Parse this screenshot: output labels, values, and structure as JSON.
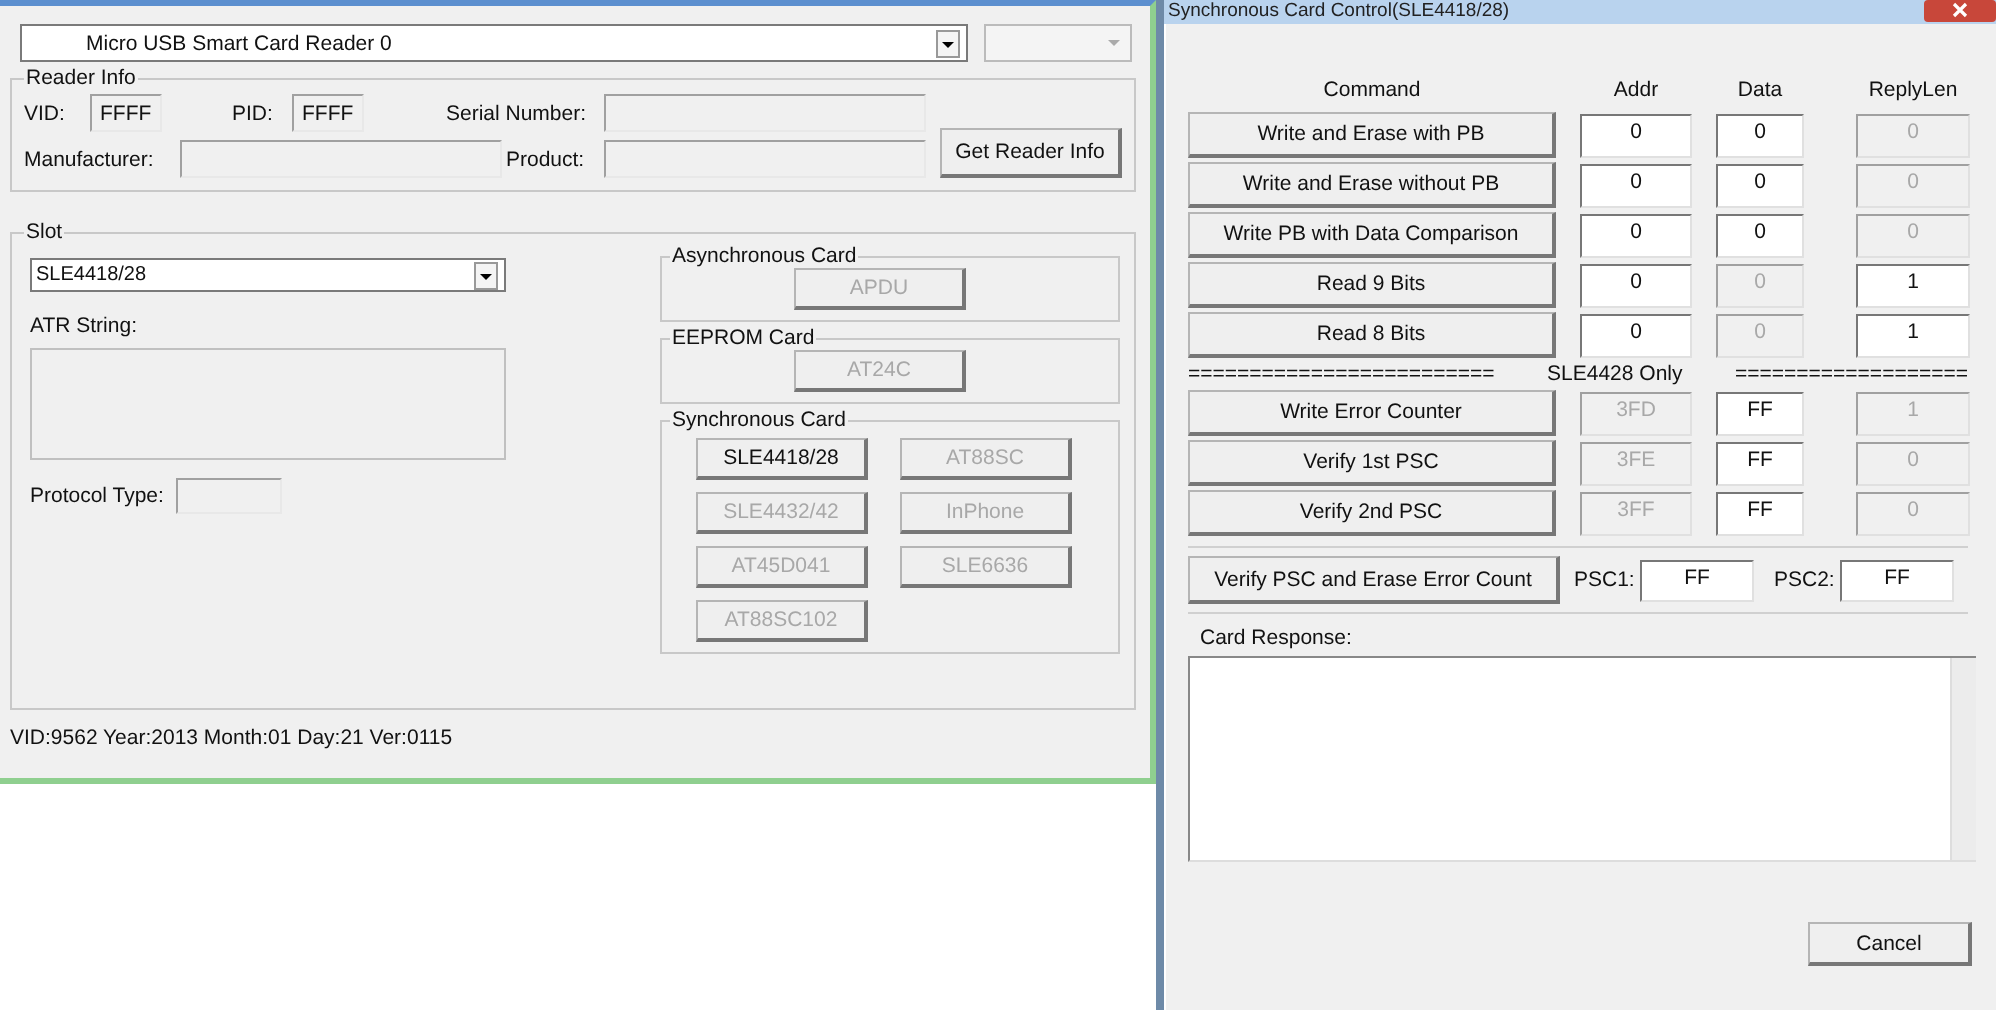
{
  "reader_window": {
    "reader_select": {
      "value": "Micro USB Smart Card Reader 0"
    },
    "reader_info": {
      "title": "Reader Info",
      "vid_label": "VID:",
      "vid": "FFFF",
      "pid_label": "PID:",
      "pid": "FFFF",
      "serial_label": "Serial Number:",
      "manufacturer_label": "Manufacturer:",
      "product_label": "Product:",
      "button": "Get Reader Info"
    },
    "slot": {
      "title": "Slot",
      "card_select": {
        "value": "SLE4418/28"
      },
      "atr_label": "ATR String:",
      "protocol_label": "Protocol Type:",
      "groups": [
        {
          "title": "Asynchronous Card",
          "buttons": [
            {
              "label": "APDU",
              "disabled": true
            }
          ]
        },
        {
          "title": "EEPROM Card",
          "buttons": [
            {
              "label": "AT24C",
              "disabled": true
            }
          ]
        },
        {
          "title": "Synchronous Card",
          "buttons": [
            {
              "label": "SLE4418/28",
              "disabled": false
            },
            {
              "label": "AT88SC",
              "disabled": true
            },
            {
              "label": "SLE4432/42",
              "disabled": true
            },
            {
              "label": "InPhone",
              "disabled": true
            },
            {
              "label": "AT45D041",
              "disabled": true
            },
            {
              "label": "SLE6636",
              "disabled": true
            },
            {
              "label": "AT88SC102",
              "disabled": true
            }
          ]
        }
      ]
    },
    "status": "VID:9562 Year:2013 Month:01 Day:21 Ver:0115"
  },
  "control_window": {
    "title": "Synchronous Card Control(SLE4418/28)",
    "columns": [
      "Command",
      "Addr",
      "Data",
      "ReplyLen"
    ],
    "rows": [
      {
        "command": "Write and Erase with PB",
        "addr": {
          "value": "0",
          "disabled": false
        },
        "data": {
          "value": "0",
          "disabled": false
        },
        "reply_len": {
          "value": "0",
          "disabled": true
        }
      },
      {
        "command": "Write and Erase without PB",
        "addr": {
          "value": "0",
          "disabled": false
        },
        "data": {
          "value": "0",
          "disabled": false
        },
        "reply_len": {
          "value": "0",
          "disabled": true
        }
      },
      {
        "command": "Write PB with Data Comparison",
        "addr": {
          "value": "0",
          "disabled": false
        },
        "data": {
          "value": "0",
          "disabled": false
        },
        "reply_len": {
          "value": "0",
          "disabled": true
        }
      },
      {
        "command": "Read 9 Bits",
        "addr": {
          "value": "0",
          "disabled": false
        },
        "data": {
          "value": "0",
          "disabled": true
        },
        "reply_len": {
          "value": "1",
          "disabled": false
        }
      },
      {
        "command": "Read 8 Bits",
        "addr": {
          "value": "0",
          "disabled": false
        },
        "data": {
          "value": "0",
          "disabled": true
        },
        "reply_len": {
          "value": "1",
          "disabled": false
        }
      }
    ],
    "separator": {
      "left": "=========================",
      "label": "SLE4428 Only",
      "right": "==================="
    },
    "sle4428_rows": [
      {
        "command": "Write Error Counter",
        "addr": {
          "value": "3FD",
          "disabled": true
        },
        "data": {
          "value": "FF",
          "disabled": false
        },
        "reply_len": {
          "value": "1",
          "disabled": true
        }
      },
      {
        "command": "Verify 1st PSC",
        "addr": {
          "value": "3FE",
          "disabled": true
        },
        "data": {
          "value": "FF",
          "disabled": false
        },
        "reply_len": {
          "value": "0",
          "disabled": true
        }
      },
      {
        "command": "Verify 2nd PSC",
        "addr": {
          "value": "3FF",
          "disabled": true
        },
        "data": {
          "value": "FF",
          "disabled": false
        },
        "reply_len": {
          "value": "0",
          "disabled": true
        }
      }
    ],
    "verify_button": "Verify PSC and Erase Error Count",
    "psc1_label": "PSC1:",
    "psc1": "FF",
    "psc2_label": "PSC2:",
    "psc2": "FF",
    "response_label": "Card Response:",
    "cancel_button": "Cancel"
  }
}
